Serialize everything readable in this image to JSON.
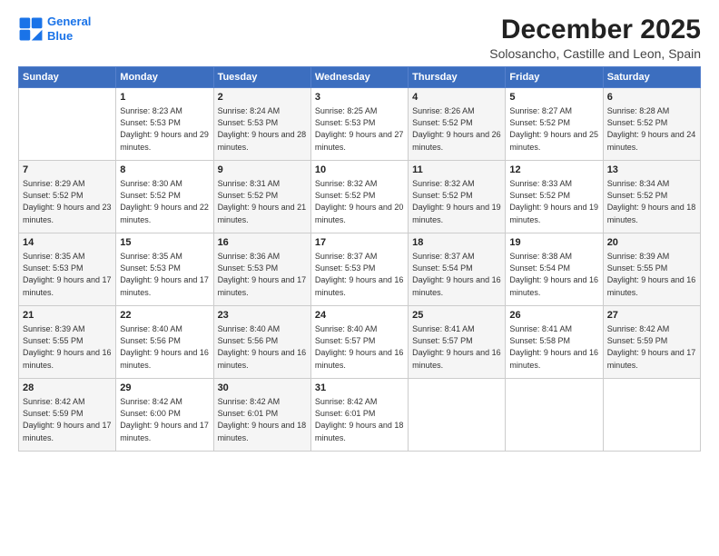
{
  "logo": {
    "line1": "General",
    "line2": "Blue"
  },
  "title": "December 2025",
  "subtitle": "Solosancho, Castille and Leon, Spain",
  "weekdays": [
    "Sunday",
    "Monday",
    "Tuesday",
    "Wednesday",
    "Thursday",
    "Friday",
    "Saturday"
  ],
  "weeks": [
    [
      {
        "day": "",
        "detail": ""
      },
      {
        "day": "1",
        "detail": "Sunrise: 8:23 AM\nSunset: 5:53 PM\nDaylight: 9 hours\nand 29 minutes."
      },
      {
        "day": "2",
        "detail": "Sunrise: 8:24 AM\nSunset: 5:53 PM\nDaylight: 9 hours\nand 28 minutes."
      },
      {
        "day": "3",
        "detail": "Sunrise: 8:25 AM\nSunset: 5:53 PM\nDaylight: 9 hours\nand 27 minutes."
      },
      {
        "day": "4",
        "detail": "Sunrise: 8:26 AM\nSunset: 5:52 PM\nDaylight: 9 hours\nand 26 minutes."
      },
      {
        "day": "5",
        "detail": "Sunrise: 8:27 AM\nSunset: 5:52 PM\nDaylight: 9 hours\nand 25 minutes."
      },
      {
        "day": "6",
        "detail": "Sunrise: 8:28 AM\nSunset: 5:52 PM\nDaylight: 9 hours\nand 24 minutes."
      }
    ],
    [
      {
        "day": "7",
        "detail": "Sunrise: 8:29 AM\nSunset: 5:52 PM\nDaylight: 9 hours\nand 23 minutes."
      },
      {
        "day": "8",
        "detail": "Sunrise: 8:30 AM\nSunset: 5:52 PM\nDaylight: 9 hours\nand 22 minutes."
      },
      {
        "day": "9",
        "detail": "Sunrise: 8:31 AM\nSunset: 5:52 PM\nDaylight: 9 hours\nand 21 minutes."
      },
      {
        "day": "10",
        "detail": "Sunrise: 8:32 AM\nSunset: 5:52 PM\nDaylight: 9 hours\nand 20 minutes."
      },
      {
        "day": "11",
        "detail": "Sunrise: 8:32 AM\nSunset: 5:52 PM\nDaylight: 9 hours\nand 19 minutes."
      },
      {
        "day": "12",
        "detail": "Sunrise: 8:33 AM\nSunset: 5:52 PM\nDaylight: 9 hours\nand 19 minutes."
      },
      {
        "day": "13",
        "detail": "Sunrise: 8:34 AM\nSunset: 5:52 PM\nDaylight: 9 hours\nand 18 minutes."
      }
    ],
    [
      {
        "day": "14",
        "detail": "Sunrise: 8:35 AM\nSunset: 5:53 PM\nDaylight: 9 hours\nand 17 minutes."
      },
      {
        "day": "15",
        "detail": "Sunrise: 8:35 AM\nSunset: 5:53 PM\nDaylight: 9 hours\nand 17 minutes."
      },
      {
        "day": "16",
        "detail": "Sunrise: 8:36 AM\nSunset: 5:53 PM\nDaylight: 9 hours\nand 17 minutes."
      },
      {
        "day": "17",
        "detail": "Sunrise: 8:37 AM\nSunset: 5:53 PM\nDaylight: 9 hours\nand 16 minutes."
      },
      {
        "day": "18",
        "detail": "Sunrise: 8:37 AM\nSunset: 5:54 PM\nDaylight: 9 hours\nand 16 minutes."
      },
      {
        "day": "19",
        "detail": "Sunrise: 8:38 AM\nSunset: 5:54 PM\nDaylight: 9 hours\nand 16 minutes."
      },
      {
        "day": "20",
        "detail": "Sunrise: 8:39 AM\nSunset: 5:55 PM\nDaylight: 9 hours\nand 16 minutes."
      }
    ],
    [
      {
        "day": "21",
        "detail": "Sunrise: 8:39 AM\nSunset: 5:55 PM\nDaylight: 9 hours\nand 16 minutes."
      },
      {
        "day": "22",
        "detail": "Sunrise: 8:40 AM\nSunset: 5:56 PM\nDaylight: 9 hours\nand 16 minutes."
      },
      {
        "day": "23",
        "detail": "Sunrise: 8:40 AM\nSunset: 5:56 PM\nDaylight: 9 hours\nand 16 minutes."
      },
      {
        "day": "24",
        "detail": "Sunrise: 8:40 AM\nSunset: 5:57 PM\nDaylight: 9 hours\nand 16 minutes."
      },
      {
        "day": "25",
        "detail": "Sunrise: 8:41 AM\nSunset: 5:57 PM\nDaylight: 9 hours\nand 16 minutes."
      },
      {
        "day": "26",
        "detail": "Sunrise: 8:41 AM\nSunset: 5:58 PM\nDaylight: 9 hours\nand 16 minutes."
      },
      {
        "day": "27",
        "detail": "Sunrise: 8:42 AM\nSunset: 5:59 PM\nDaylight: 9 hours\nand 17 minutes."
      }
    ],
    [
      {
        "day": "28",
        "detail": "Sunrise: 8:42 AM\nSunset: 5:59 PM\nDaylight: 9 hours\nand 17 minutes."
      },
      {
        "day": "29",
        "detail": "Sunrise: 8:42 AM\nSunset: 6:00 PM\nDaylight: 9 hours\nand 17 minutes."
      },
      {
        "day": "30",
        "detail": "Sunrise: 8:42 AM\nSunset: 6:01 PM\nDaylight: 9 hours\nand 18 minutes."
      },
      {
        "day": "31",
        "detail": "Sunrise: 8:42 AM\nSunset: 6:01 PM\nDaylight: 9 hours\nand 18 minutes."
      },
      {
        "day": "",
        "detail": ""
      },
      {
        "day": "",
        "detail": ""
      },
      {
        "day": "",
        "detail": ""
      }
    ]
  ]
}
